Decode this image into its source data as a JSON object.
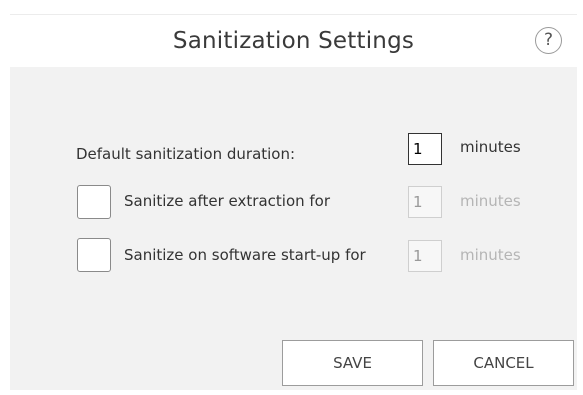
{
  "dialog": {
    "title": "Sanitization Settings",
    "help_label": "?"
  },
  "settings": {
    "default_duration": {
      "label": "Default sanitization duration:",
      "value": "1",
      "unit": "minutes",
      "enabled": true
    },
    "after_extraction": {
      "label": "Sanitize after extraction for",
      "checked": false,
      "value": "1",
      "unit": "minutes",
      "enabled": false
    },
    "on_startup": {
      "label": "Sanitize on software start-up for",
      "checked": false,
      "value": "1",
      "unit": "minutes",
      "enabled": false
    }
  },
  "buttons": {
    "save_label": "SAVE",
    "cancel_label": "CANCEL"
  },
  "colors": {
    "body_background": "#f2f2f2",
    "header_background": "#ffffff",
    "disabled_text": "#b5b5b5"
  }
}
